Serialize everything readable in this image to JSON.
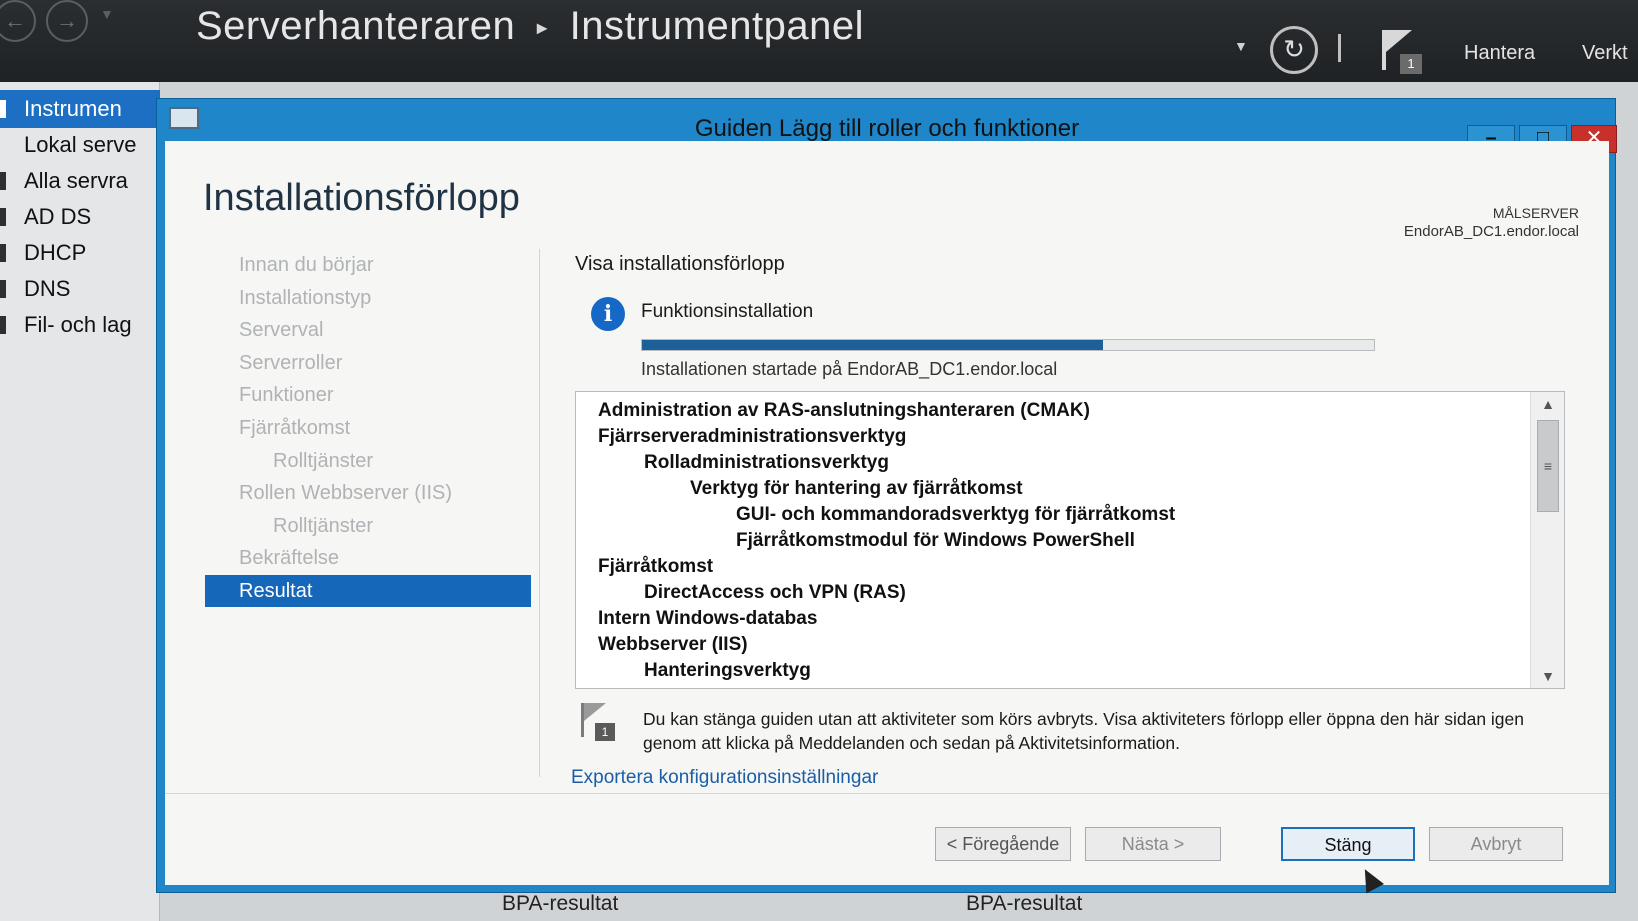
{
  "app": {
    "breadcrumb_root": "Serverhanteraren",
    "breadcrumb_page": "Instrumentpanel",
    "manage_label": "Hantera",
    "tools_label": "Verkt",
    "flag_count": "1"
  },
  "sidebar": {
    "items": [
      {
        "label": "Instrumen",
        "active": true
      },
      {
        "label": "Lokal serve"
      },
      {
        "label": "Alla servra"
      },
      {
        "label": "AD DS"
      },
      {
        "label": "DHCP"
      },
      {
        "label": "DNS"
      },
      {
        "label": "Fil- och lag"
      }
    ]
  },
  "background": {
    "bpa_left": "BPA-resultat",
    "bpa_right": "BPA-resultat"
  },
  "wizard": {
    "title": "Guiden Lägg till roller och funktioner",
    "page_title": "Installationsförlopp",
    "target_server_label": "MÅLSERVER",
    "target_server_value": "EndorAB_DC1.endor.local",
    "steps": [
      {
        "label": "Innan du börjar"
      },
      {
        "label": "Installationstyp"
      },
      {
        "label": "Serverval"
      },
      {
        "label": "Serverroller"
      },
      {
        "label": "Funktioner"
      },
      {
        "label": "Fjärråtkomst"
      },
      {
        "label": "Rolltjänster",
        "sub": true
      },
      {
        "label": "Rollen Webbserver (IIS)"
      },
      {
        "label": "Rolltjänster",
        "sub": true
      },
      {
        "label": "Bekräftelse"
      },
      {
        "label": "Resultat",
        "active": true
      }
    ],
    "section_title": "Visa installationsförlopp",
    "progress_title": "Funktionsinstallation",
    "progress_fraction": 0.63,
    "progress_status": "Installationen startade på EndorAB_DC1.endor.local",
    "features": [
      {
        "label": "Administration av RAS-anslutningshanteraren (CMAK)",
        "level": 0
      },
      {
        "label": "Fjärrserveradministrationsverktyg",
        "level": 0
      },
      {
        "label": "Rolladministrationsverktyg",
        "level": 1
      },
      {
        "label": "Verktyg för hantering av fjärråtkomst",
        "level": 2
      },
      {
        "label": "GUI- och kommandoradsverktyg för fjärråtkomst",
        "level": 3
      },
      {
        "label": "Fjärråtkomstmodul för Windows PowerShell",
        "level": 3
      },
      {
        "label": "Fjärråtkomst",
        "level": 0
      },
      {
        "label": "DirectAccess och VPN (RAS)",
        "level": 1
      },
      {
        "label": "Intern Windows-databas",
        "level": 0
      },
      {
        "label": "Webbserver (IIS)",
        "level": 0
      },
      {
        "label": "Hanteringsverktyg",
        "level": 1
      }
    ],
    "note_flag_count": "1",
    "note": "Du kan stänga guiden utan att aktiviteter som körs avbryts. Visa aktiviteters förlopp eller öppna den här sidan igen genom att klicka på Meddelanden och sedan på Aktivitetsinformation.",
    "export_link": "Exportera konfigurationsinställningar",
    "buttons": {
      "prev": "< Föregående",
      "next": "Nästa >",
      "close": "Stäng",
      "cancel": "Avbryt"
    }
  },
  "colors": {
    "titlebar": "#1f86c9",
    "selection": "#1567b9",
    "progress": "#1d5f98",
    "close_button": "#c7302b"
  }
}
